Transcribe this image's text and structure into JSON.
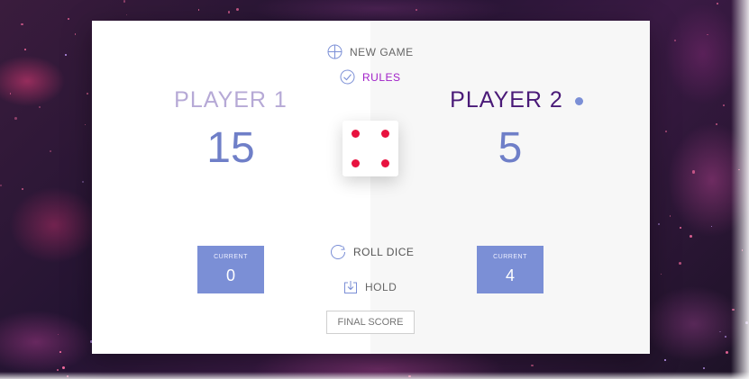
{
  "game": {
    "new_game_label": "NEW GAME",
    "rules_label": "RULES",
    "roll_dice_label": "ROLL DICE",
    "hold_label": "HOLD",
    "final_score_placeholder": "FINAL SCORE"
  },
  "players": [
    {
      "name": "PLAYER 1",
      "score": "15",
      "current_label": "CURRENT",
      "current": "0",
      "active": false
    },
    {
      "name": "PLAYER 2",
      "score": "5",
      "current_label": "CURRENT",
      "current": "4",
      "active": true
    }
  ],
  "dice": {
    "value": 4,
    "pip_color": "#e8123f"
  },
  "colors": {
    "accent": "#7b8fd6",
    "rules": "#a020c8",
    "active_name": "#4a1a78",
    "inactive_name": "#b6a9d6"
  },
  "icons": {
    "new_game": "plus-circle-icon",
    "rules": "check-circle-icon",
    "roll_dice": "refresh-icon",
    "hold": "download-box-icon",
    "active_player": "dot-icon"
  }
}
